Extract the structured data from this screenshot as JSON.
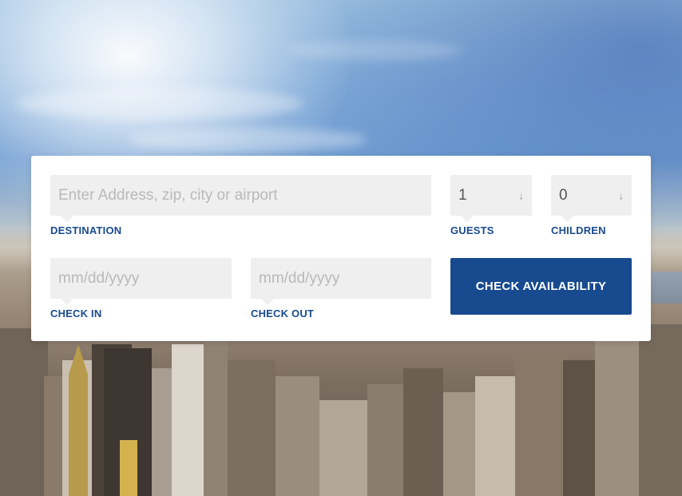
{
  "booking_form": {
    "destination": {
      "placeholder": "Enter Address, zip, city or airport",
      "label": "DESTINATION"
    },
    "guests": {
      "value": "1",
      "label": "GUESTS"
    },
    "children": {
      "value": "0",
      "label": "CHILDREN"
    },
    "check_in": {
      "placeholder": "mm/dd/yyyy",
      "label": "CHECK IN"
    },
    "check_out": {
      "placeholder": "mm/dd/yyyy",
      "label": "CHECK OUT"
    },
    "submit_label": "CHECK AVAILABILITY",
    "dropdown_arrow_glyph": "↓"
  },
  "colors": {
    "accent": "#174a8e",
    "label": "#1a4b8c",
    "field_bg": "#efefef"
  }
}
